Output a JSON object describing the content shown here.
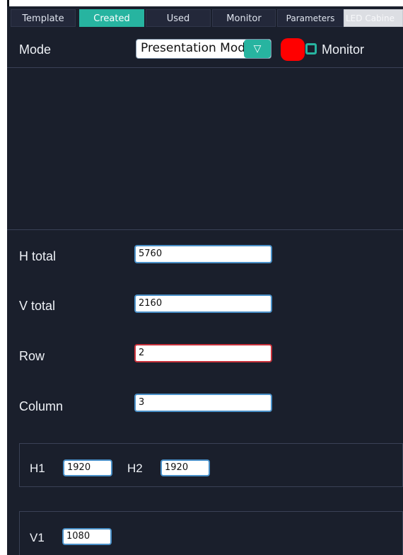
{
  "tabs": [
    "Template",
    "Created",
    "Used",
    "Monitor",
    "Parameters",
    "LED Cabine"
  ],
  "mode": {
    "label": "Mode",
    "value": "Presentation Mode",
    "arrow": "▽",
    "monitor_label": "Monitor",
    "indicator_color": "#ff0000"
  },
  "fields": {
    "h_total": {
      "label": "H total",
      "value": "5760"
    },
    "v_total": {
      "label": "V total",
      "value": "2160"
    },
    "row": {
      "label": "Row",
      "value": "2"
    },
    "column": {
      "label": "Column",
      "value": "3"
    }
  },
  "h_group": {
    "h1_label": "H1",
    "h1_value": "1920",
    "h2_label": "H2",
    "h2_value": "1920"
  },
  "v_group": {
    "v1_label": "V1",
    "v1_value": "1080"
  },
  "colors": {
    "accent": "#27b4a0",
    "background": "#1a1f2c",
    "focus_border": "#c8323c"
  }
}
